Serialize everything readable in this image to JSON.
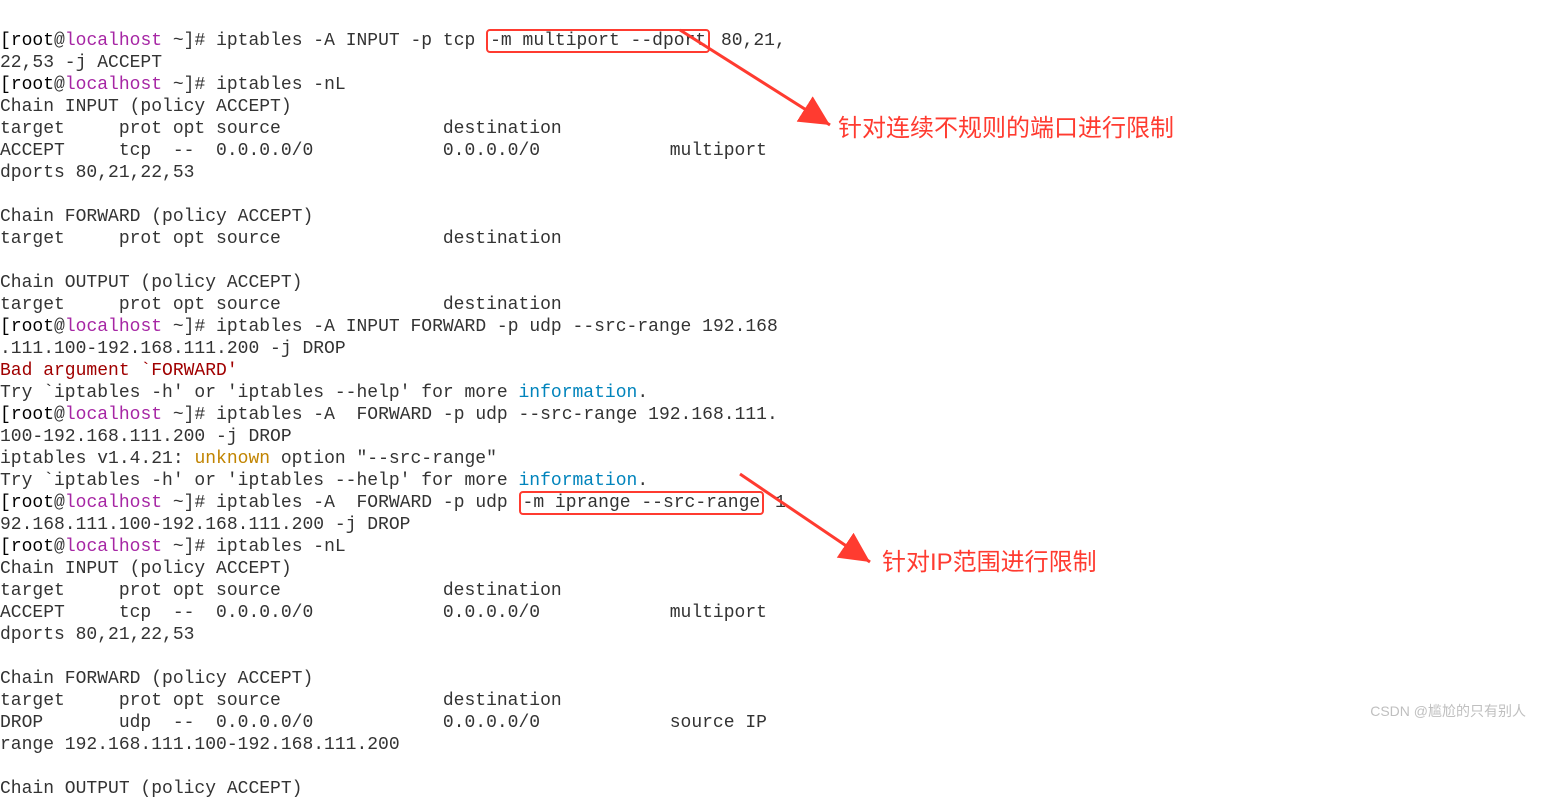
{
  "prompt": {
    "open": "[",
    "root": "root",
    "at": "@",
    "host": "localhost",
    "rest": " ~]# "
  },
  "lines": {
    "cmd1a": "iptables -A INPUT -p tcp ",
    "box1": "-m multiport --dport",
    "cmd1b": " 80,21,",
    "cmd1c": "22,53 -j ACCEPT",
    "cmd2": "iptables -nL",
    "chainInput": "Chain INPUT (policy ACCEPT)",
    "header": "target     prot opt source               destination         ",
    "acceptLine": "ACCEPT     tcp  --  0.0.0.0/0            0.0.0.0/0            multiport ",
    "dports": "dports 80,21,22,53",
    "blank": "",
    "chainForward": "Chain FORWARD (policy ACCEPT)",
    "chainOutput": "Chain OUTPUT (policy ACCEPT)",
    "cmd3a": "iptables -A INPUT FORWARD -p udp --src-range 192.168",
    "cmd3b": ".111.100-192.168.111.200 -j DROP",
    "badArg": "Bad argument `FORWARD'",
    "tryA": "Try `iptables -h' or 'iptables --help' for more ",
    "infoWord": "information",
    "dot": ".",
    "cmd4a": "iptables -A  FORWARD -p udp --src-range 192.168.111.",
    "cmd4b": "100-192.168.111.200 -j DROP",
    "verLine1": "iptables v1.4.21: ",
    "unknown": "unknown",
    "verLine2": " option \"--src-range\"",
    "cmd5a": "iptables -A  FORWARD -p udp ",
    "box2": "-m iprange --src-range",
    "cmd5b": " 1",
    "cmd5c": "92.168.111.100-192.168.111.200 -j DROP",
    "dropLine": "DROP       udp  --  0.0.0.0/0            0.0.0.0/0            source IP ",
    "rangeLine": "range 192.168.111.100-192.168.111.200"
  },
  "annotations": {
    "a1": "针对连续不规则的端口进行限制",
    "a2": "针对IP范围进行限制"
  },
  "watermark": "CSDN @尴尬的只有别人"
}
